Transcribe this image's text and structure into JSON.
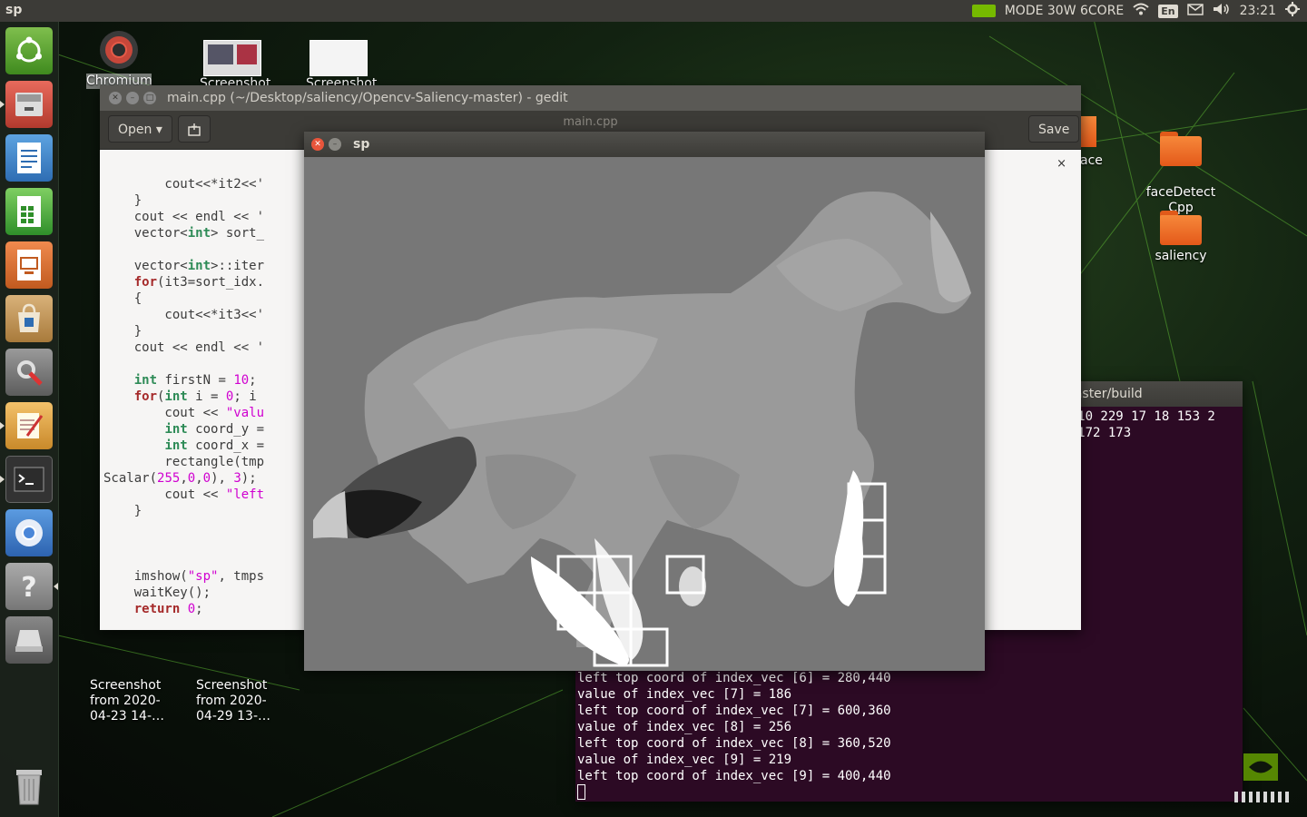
{
  "top_panel": {
    "app_name": "sp",
    "power_mode": "MODE 30W 6CORE",
    "keyboard_layout": "En",
    "clock": "23:21"
  },
  "launcher": {
    "items": [
      "ubuntu-icon",
      "file-cabinet-icon",
      "writer-document-icon",
      "calc-spreadsheet-icon",
      "impress-presentation-icon",
      "software-store-icon",
      "system-settings-icon",
      "text-editor-icon",
      "terminal-icon",
      "chromium-icon",
      "help-icon",
      "drive-icon",
      "trash-icon"
    ]
  },
  "desktop_icons": {
    "chromium": "Chromium",
    "screenshot_top_1": "Screenshot",
    "screenshot_top_2": "Screenshot",
    "workspace_partial": "ace",
    "facedetect": "faceDetect\nCpp",
    "saliency": "saliency",
    "screenshot_bottom_1": "Screenshot\nfrom 2020-\n04-23 14-…",
    "screenshot_bottom_2": "Screenshot\nfrom 2020-\n04-29 13-…"
  },
  "gedit": {
    "title": "main.cpp (~/Desktop/saliency/Opencv-Saliency-master) - gedit",
    "open_label": "Open",
    "subtitle": "main.cpp",
    "save_label": "Save",
    "tab_close": "×"
  },
  "terminal": {
    "title": "cv-Saliency-master/build",
    "top_lines": [
      "96 114 115 210 229 17 18 153 2",
      "192 174 191 172 173",
      "====="
    ],
    "bottom_lines": [
      "left top coord of index_vec [6] = 280,440",
      "value of index_vec [7] = 186",
      "left top coord of index_vec [7] = 600,360",
      "value of index_vec [8] = 256",
      "left top coord of index_vec [8] = 360,520",
      "value of index_vec [9] = 219",
      "left top coord of index_vec [9] = 400,440"
    ]
  },
  "sp_window": {
    "title": "sp"
  },
  "colors": {
    "panel": "#3c3b37",
    "terminal_bg": "#2c0a24",
    "nvidia_green": "#76b900",
    "sp_bg": "#7c7c7c"
  }
}
